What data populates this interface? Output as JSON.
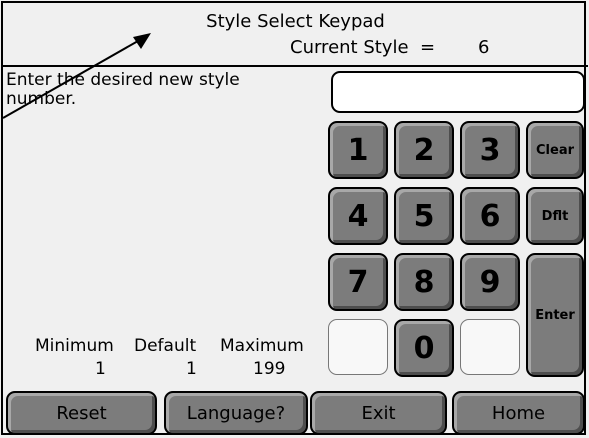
{
  "header": {
    "title": "Style Select Keypad",
    "current_label": "Current Style  =",
    "current_value": "6"
  },
  "prompt": "Enter the desired new style number.",
  "entry": {
    "value": ""
  },
  "keypad": {
    "k1": "1",
    "k2": "2",
    "k3": "3",
    "k4": "4",
    "k5": "5",
    "k6": "6",
    "k7": "7",
    "k8": "8",
    "k9": "9",
    "k0": "0",
    "clear": "Clear",
    "default": "Dflt",
    "enter": "Enter"
  },
  "limits": {
    "min_label": "Minimum",
    "min_value": "1",
    "def_label": "Default",
    "def_value": "1",
    "max_label": "Maximum",
    "max_value": "199"
  },
  "footer": {
    "reset": "Reset",
    "language": "Language?",
    "exit": "Exit",
    "home": "Home"
  }
}
